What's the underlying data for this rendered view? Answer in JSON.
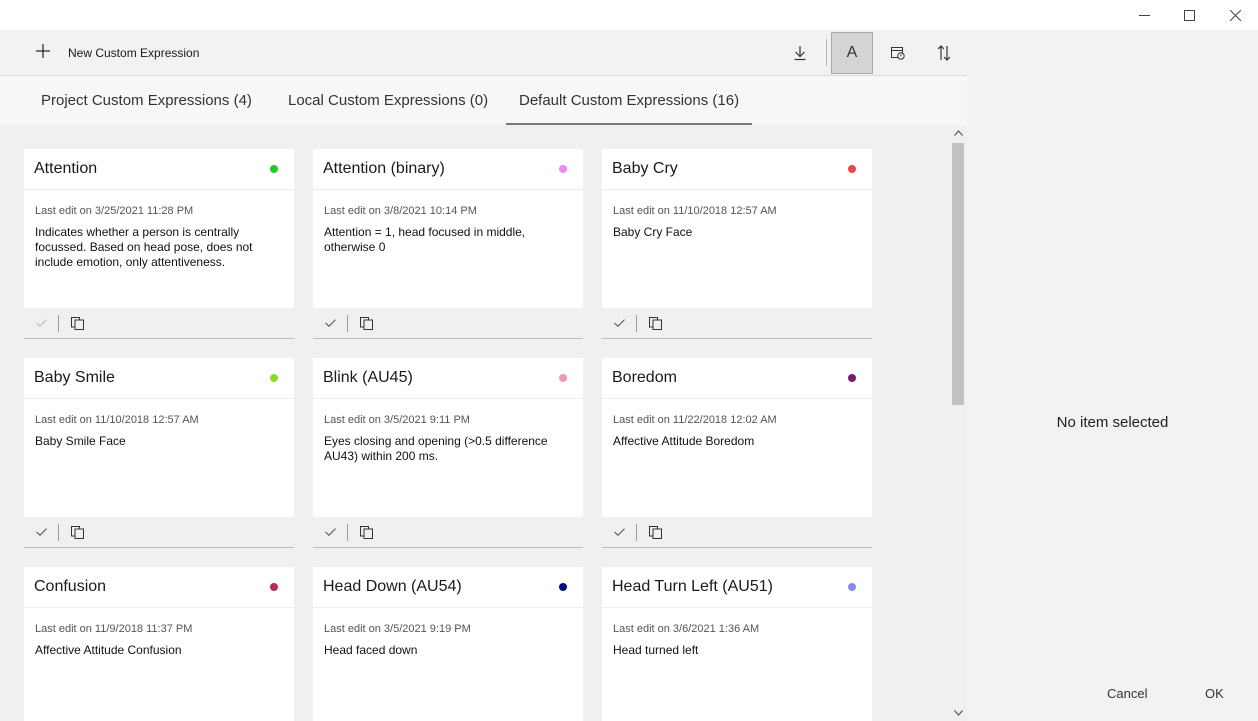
{
  "window": {
    "minimize_icon": "minimize-icon",
    "maximize_icon": "maximize-icon",
    "close_icon": "close-icon"
  },
  "toolbar": {
    "new_label": "New Custom Expression",
    "font_button_label": "A",
    "icons": [
      "plus-icon",
      "download-icon",
      "font-icon",
      "calendar-icon",
      "sort-icon"
    ]
  },
  "tabs": [
    {
      "label": "Project Custom Expressions (4)",
      "selected": false
    },
    {
      "label": "Local Custom Expressions (0)",
      "selected": false
    },
    {
      "label": "Default Custom Expressions (16)",
      "selected": true
    }
  ],
  "cards": [
    {
      "title": "Attention",
      "color": "#22cc22",
      "date": "Last edit on 3/25/2021 11:28 PM",
      "desc": "Indicates whether a person is centrally focussed. Based on head pose, does not include emotion, only attentiveness.",
      "check_enabled": false
    },
    {
      "title": "Attention (binary)",
      "color": "#ee88ee",
      "date": "Last edit on 3/8/2021 10:14 PM",
      "desc": "Attention = 1, head focused in middle, otherwise 0",
      "check_enabled": true
    },
    {
      "title": "Baby Cry",
      "color": "#ee4444",
      "date": "Last edit on 11/10/2018 12:57 AM",
      "desc": "Baby Cry Face",
      "check_enabled": true
    },
    {
      "title": "Baby Smile",
      "color": "#88dd22",
      "date": "Last edit on 11/10/2018 12:57 AM",
      "desc": "Baby Smile Face",
      "check_enabled": true
    },
    {
      "title": "Blink (AU45)",
      "color": "#ee99bb",
      "date": "Last edit on 3/5/2021 9:11 PM",
      "desc": "Eyes closing and opening (>0.5 difference AU43) within 200 ms.",
      "check_enabled": true
    },
    {
      "title": "Boredom",
      "color": "#7a1a6e",
      "date": "Last edit on 11/22/2018 12:02 AM",
      "desc": "Affective Attitude Boredom",
      "check_enabled": true
    },
    {
      "title": "Confusion",
      "color": "#b03050",
      "date": "Last edit on 11/9/2018 11:37 PM",
      "desc": "Affective Attitude Confusion",
      "check_enabled": true
    },
    {
      "title": "Head Down (AU54)",
      "color": "#0a0a80",
      "date": "Last edit on 3/5/2021 9:19 PM",
      "desc": "Head faced down",
      "check_enabled": true
    },
    {
      "title": "Head Turn Left (AU51)",
      "color": "#8888ee",
      "date": "Last edit on 3/6/2021 1:36 AM",
      "desc": "Head turned left",
      "check_enabled": true
    }
  ],
  "detail_pane": {
    "empty_text": "No item selected",
    "cancel_label": "Cancel",
    "ok_label": "OK"
  }
}
